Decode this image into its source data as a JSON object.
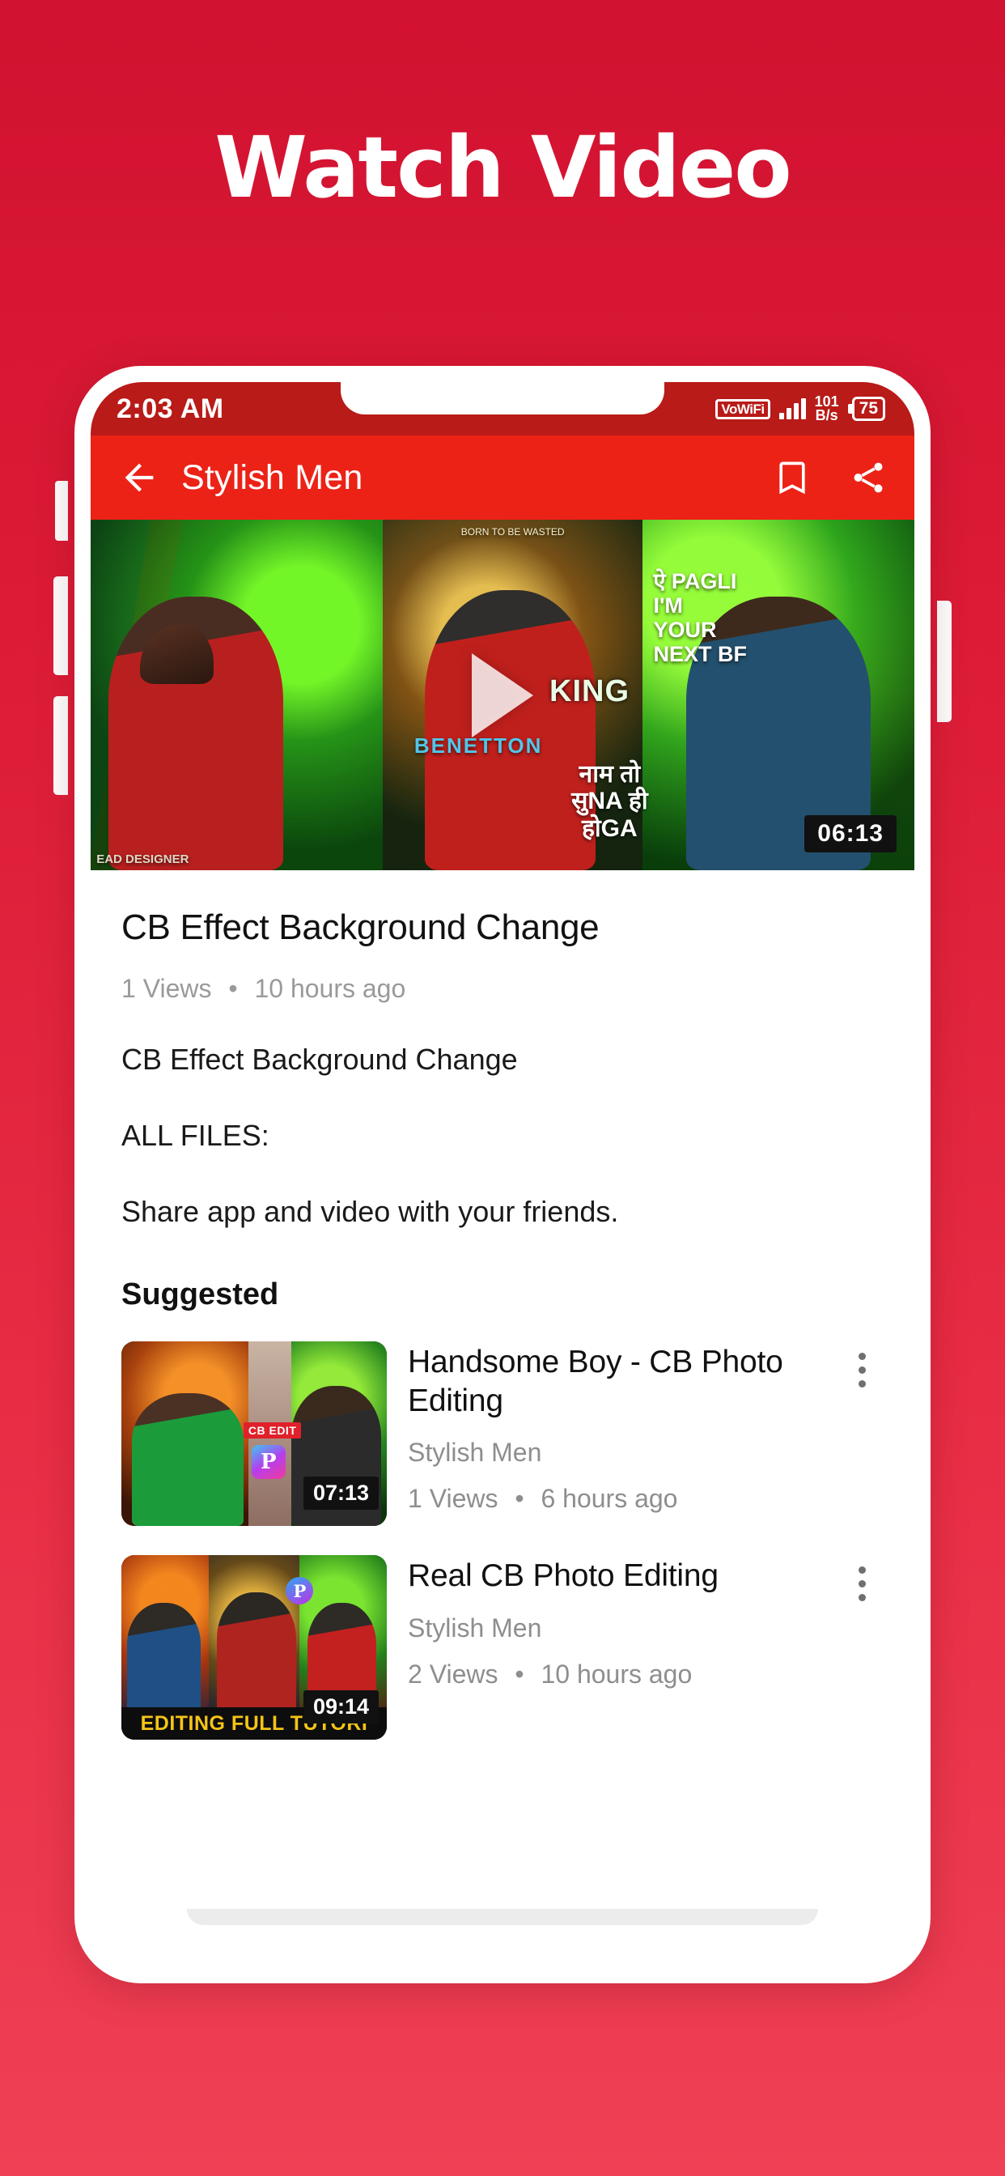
{
  "page": {
    "headline": "Watch Video",
    "background_top_color": "#D11230",
    "background_bottom_color": "#EF4055"
  },
  "status_bar": {
    "time": "2:03 AM",
    "vowifi_label": "VoWiFi",
    "network_speed_value": "101",
    "network_speed_unit": "B/s",
    "battery_level": "75"
  },
  "app_bar": {
    "title": "Stylish Men",
    "back_icon": "arrow-left-icon",
    "bookmark_icon": "bookmark-icon",
    "share_icon": "share-icon",
    "background_color": "#EC2217"
  },
  "player": {
    "duration": "06:13",
    "play_icon": "play-triangle-icon",
    "overlay_texts": {
      "left_caption": "नाम तो\nसुNA ही\nहोGA",
      "left_watermark": "EAD DESIGNER",
      "center_top": "BORN TO BE WASTED",
      "center_shirt": "BENETTON",
      "center_king": "KING",
      "right_caption": "ऐ PAGLI\nI'M\nYOUR\nNEXT BF"
    }
  },
  "video": {
    "title": "CB Effect Background Change",
    "views": "1 Views",
    "separator": "•",
    "uploaded": "10 hours ago",
    "description": "CB Effect Background Change",
    "files_label": "ALL FILES:",
    "share_note": "Share app and video with your friends."
  },
  "suggested": {
    "heading": "Suggested",
    "items": [
      {
        "title": "Handsome Boy - CB Photo Editing",
        "channel": "Stylish Men",
        "views": "1 Views",
        "separator": "•",
        "uploaded": "6 hours ago",
        "duration": "07:13",
        "thumb_badge": "CB EDIT",
        "thumb_app_glyph": "P",
        "menu_icon": "kebab-menu-icon"
      },
      {
        "title": "Real CB Photo Editing",
        "channel": "Stylish Men",
        "views": "2 Views",
        "separator": "•",
        "uploaded": "10 hours ago",
        "duration": "09:14",
        "thumb_banner": "EDITING FULL TUTORI",
        "thumb_app_glyph": "P",
        "menu_icon": "kebab-menu-icon"
      }
    ]
  }
}
